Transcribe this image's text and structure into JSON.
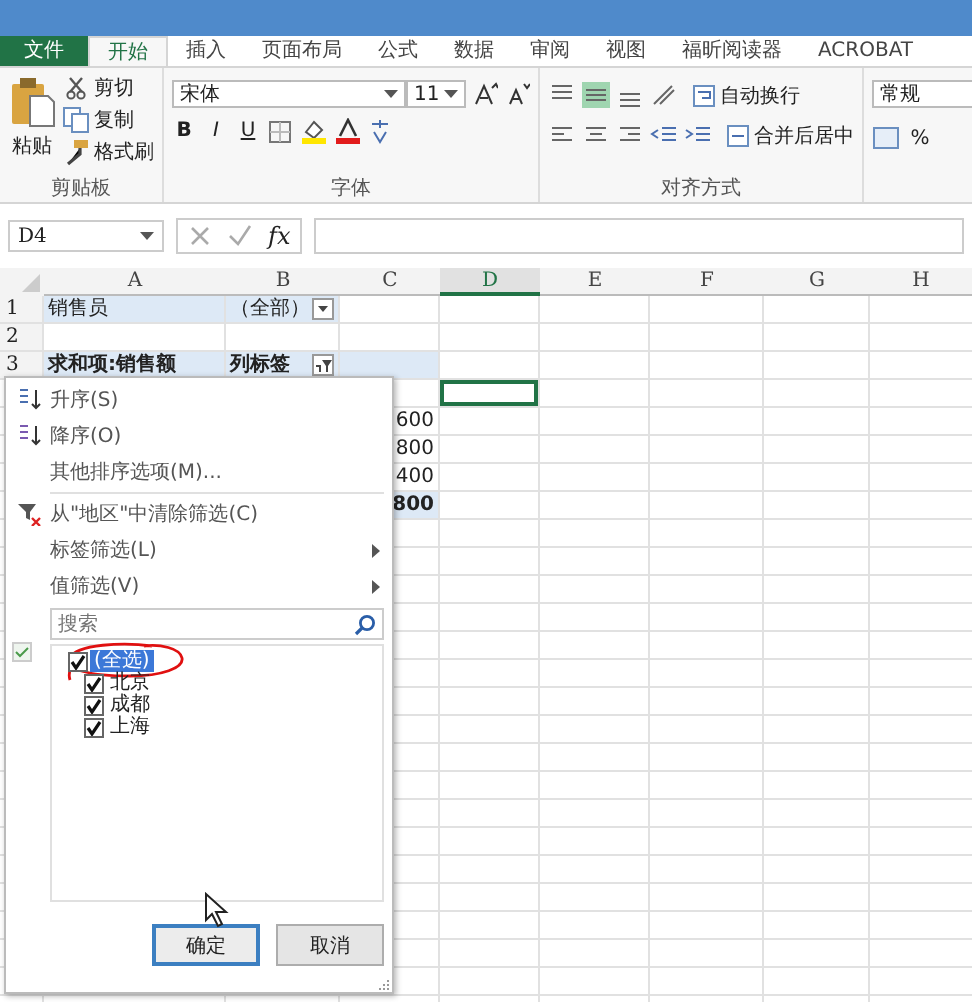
{
  "tabs": [
    {
      "label": "文件",
      "kind": "file",
      "selected": false
    },
    {
      "label": "开始",
      "kind": "tab",
      "selected": true
    },
    {
      "label": "插入",
      "kind": "tab",
      "selected": false
    },
    {
      "label": "页面布局",
      "kind": "tab",
      "selected": false
    },
    {
      "label": "公式",
      "kind": "tab",
      "selected": false
    },
    {
      "label": "数据",
      "kind": "tab",
      "selected": false
    },
    {
      "label": "审阅",
      "kind": "tab",
      "selected": false
    },
    {
      "label": "视图",
      "kind": "tab",
      "selected": false
    },
    {
      "label": "福昕阅读器",
      "kind": "tab",
      "selected": false
    },
    {
      "label": "ACROBAT",
      "kind": "tab",
      "selected": false
    }
  ],
  "ribbon": {
    "clipboard": {
      "paste": "粘贴",
      "cut": "剪切",
      "copy": "复制",
      "format_painter": "格式刷",
      "label": "剪贴板"
    },
    "font": {
      "name": "宋体",
      "size": "11",
      "bold": "B",
      "italic": "I",
      "underline": "U",
      "label": "字体"
    },
    "alignment": {
      "vertical": [
        {
          "selected": false
        },
        {
          "selected": true
        },
        {
          "selected": false
        }
      ],
      "wrap": "自动换行",
      "merge": "合并后居中",
      "label": "对齐方式"
    },
    "number": {
      "format": "常规",
      "percent": "%"
    }
  },
  "name_box": {
    "value": "D4"
  },
  "formula_bar": {
    "function_label": "fx"
  },
  "sheet": {
    "columns": [
      {
        "label": "A",
        "selected": false
      },
      {
        "label": "B",
        "selected": false
      },
      {
        "label": "C",
        "selected": false
      },
      {
        "label": "D",
        "selected": true
      },
      {
        "label": "E",
        "selected": false
      },
      {
        "label": "F",
        "selected": false
      },
      {
        "label": "G",
        "selected": false
      },
      {
        "label": "H",
        "selected": false
      }
    ],
    "rows": [
      {
        "header": "1",
        "kind": "filter",
        "cells": {
          "A": {
            "text": "销售员"
          },
          "B": {
            "text": "（全部）",
            "filtered": false
          }
        }
      },
      {
        "header": "2",
        "kind": "blank",
        "cells": {}
      },
      {
        "header": "3",
        "kind": "heading",
        "cells": {
          "A": {
            "text": "求和项:销售额"
          },
          "B": {
            "text": "列标签",
            "filtered": true
          }
        }
      },
      {
        "kind": "value",
        "cells": {
          "D": {
            "selected": true
          }
        }
      },
      {
        "kind": "value",
        "cells": {
          "C": {
            "text": "600"
          }
        }
      },
      {
        "kind": "value",
        "cells": {
          "C": {
            "text": "800"
          }
        }
      },
      {
        "kind": "value",
        "cells": {
          "C": {
            "text": "400"
          }
        }
      },
      {
        "kind": "total",
        "cells": {
          "C": {
            "text": "800"
          }
        }
      }
    ]
  },
  "filter_menu": {
    "items": [
      {
        "label": "升序(S)",
        "kind": "sort_asc",
        "submenu": false
      },
      {
        "label": "降序(O)",
        "kind": "sort_desc",
        "submenu": false
      },
      {
        "label": "其他排序选项(M)...",
        "kind": "plain",
        "submenu": false
      },
      {
        "label": "从\"地区\"中清除筛选(C)",
        "kind": "clear_filter",
        "submenu": false
      },
      {
        "label": "标签筛选(L)",
        "kind": "plain",
        "submenu": true
      },
      {
        "label": "值筛选(V)",
        "kind": "plain",
        "submenu": true
      }
    ],
    "search": {
      "placeholder": "搜索"
    },
    "options": [
      {
        "label": "(全选)",
        "checked": true,
        "selected": true
      },
      {
        "label": "北京",
        "checked": true,
        "selected": false
      },
      {
        "label": "成都",
        "checked": true,
        "selected": false
      },
      {
        "label": "上海",
        "checked": true,
        "selected": false
      }
    ],
    "buttons": [
      {
        "label": "确定",
        "default": true
      },
      {
        "label": "取消",
        "default": false
      }
    ]
  }
}
